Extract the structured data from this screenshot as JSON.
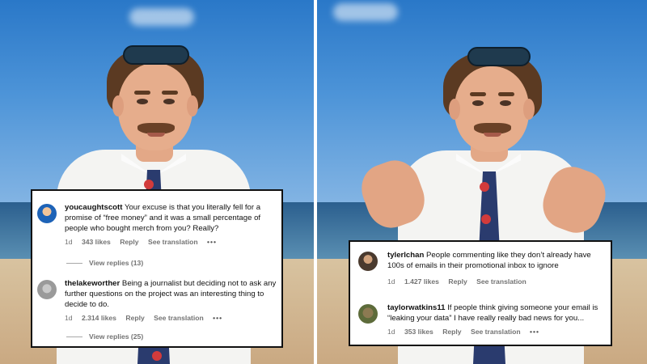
{
  "colors": {
    "card_border": "#111111",
    "meta_text": "#737373",
    "sky": "#3f8ad3",
    "sand": "#d2b893"
  },
  "left_card": {
    "comments": [
      {
        "avatar_icon": "user-avatar-icon",
        "username": "youcaughtscott",
        "text": "Your excuse is that you literally fell for a promise of “free money” and it was a small percentage of people who bought merch from you? Really?",
        "age": "1d",
        "likes": "343 likes",
        "reply_label": "Reply",
        "translation_label": "See translation",
        "more_icon": "•••",
        "view_replies": "View replies (13)"
      },
      {
        "avatar_icon": "user-avatar-icon",
        "username": "thelakeworther",
        "text": "Being a journalist but deciding not to ask any further questions on the project was an interesting thing to decide to do.",
        "age": "1d",
        "likes": "2.314 likes",
        "reply_label": "Reply",
        "translation_label": "See translation",
        "more_icon": "•••",
        "view_replies": "View replies (25)"
      }
    ]
  },
  "right_card": {
    "comments": [
      {
        "avatar_icon": "user-avatar-icon",
        "username": "tylerlchan",
        "text": "People commenting like they don’t already have 100s of emails in their promotional inbox to ignore",
        "age": "1d",
        "likes": "1.427 likes",
        "reply_label": "Reply",
        "translation_label": "See translation"
      },
      {
        "avatar_icon": "user-avatar-icon",
        "username": "taylorwatkins11",
        "text": "If people think giving someone your email is “leaking your data” I have really really bad news for you...",
        "age": "1d",
        "likes": "353 likes",
        "reply_label": "Reply",
        "translation_label": "See translation",
        "more_icon": "•••"
      }
    ]
  }
}
